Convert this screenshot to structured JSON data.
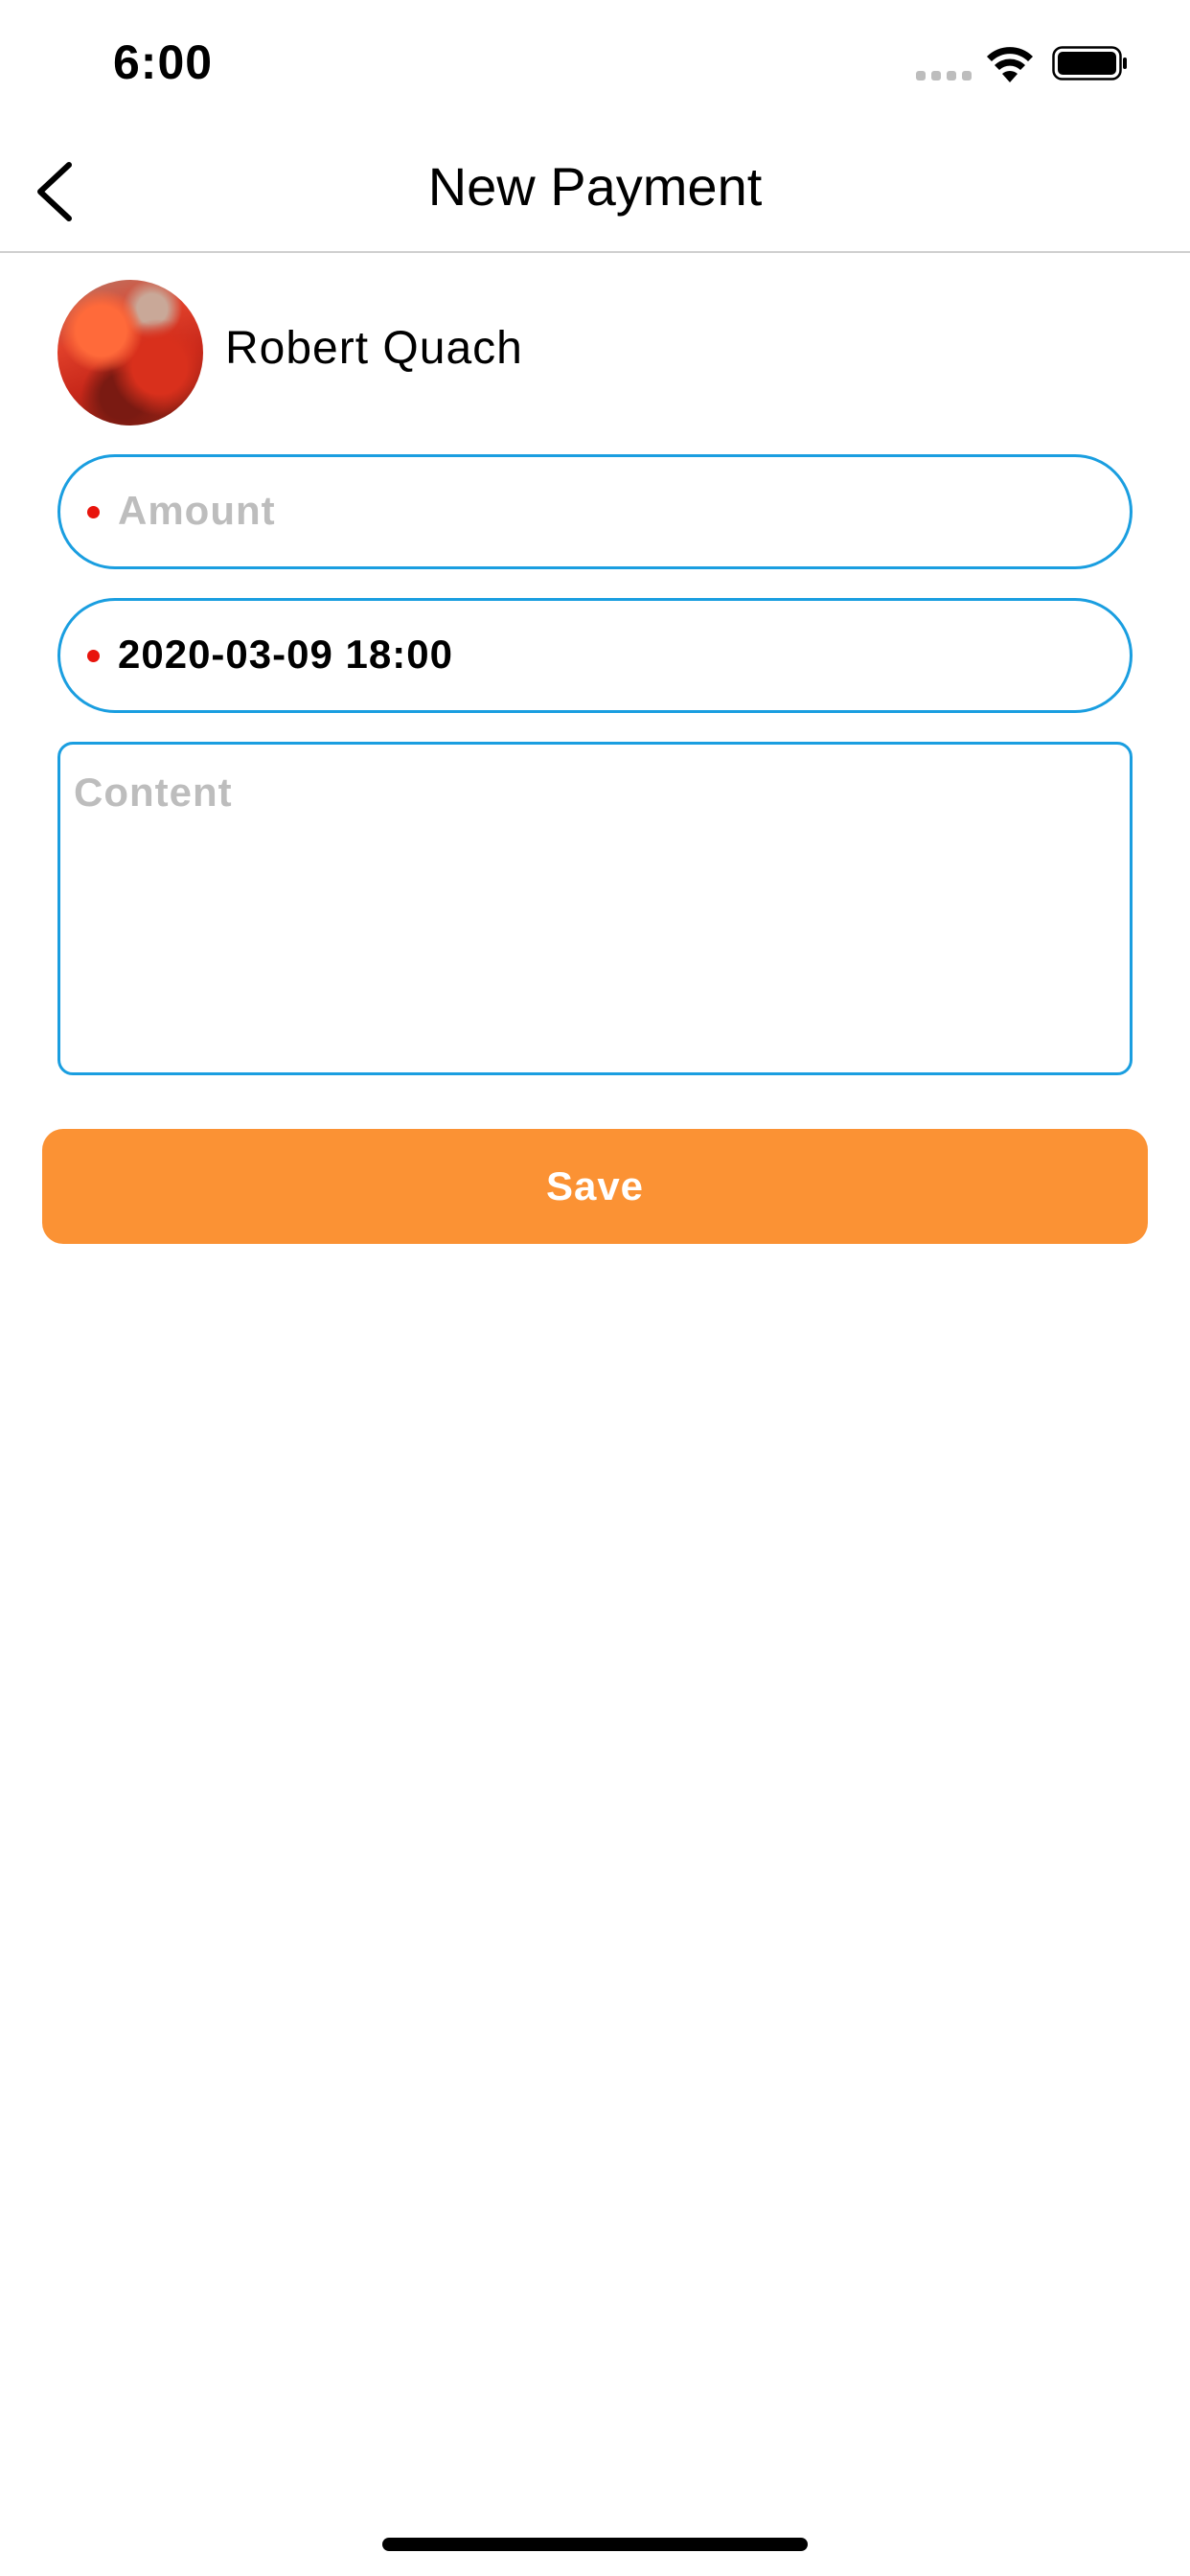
{
  "status_bar": {
    "time": "6:00",
    "icons": [
      "signal-icon",
      "wifi-icon",
      "battery-icon"
    ]
  },
  "nav": {
    "title": "New Payment",
    "back_icon": "chevron-left-icon"
  },
  "payee": {
    "name": "Robert Quach"
  },
  "form": {
    "amount_placeholder": "Amount",
    "date_value": "2020-03-09 18:00",
    "content_placeholder": "Content",
    "save_label": "Save"
  },
  "colors": {
    "field_border": "#1a9ee0",
    "required_dot": "#e8140c",
    "save_button": "#fb9234",
    "placeholder": "#bdbdbd"
  }
}
